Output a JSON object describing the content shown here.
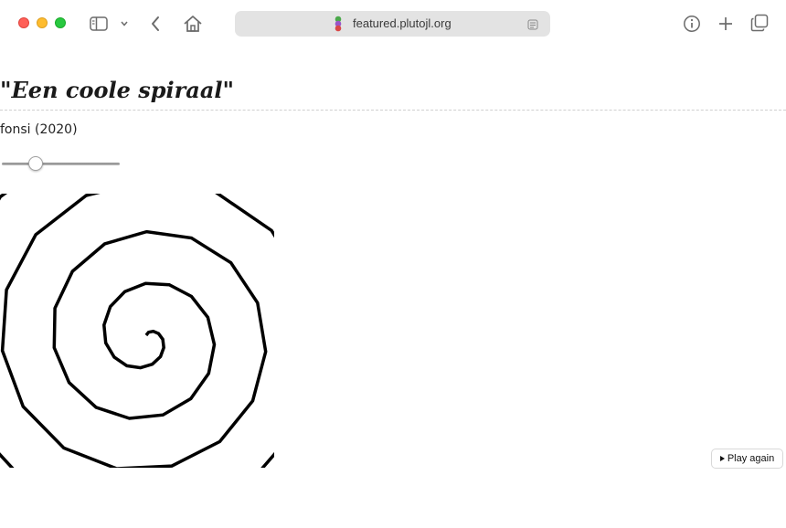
{
  "browser": {
    "address": "featured.plutojl.org",
    "icons": {
      "sidebar": "sidebar-icon",
      "chevron": "chevron-down-icon",
      "back": "back-icon",
      "home": "home-icon",
      "site": "pluto-logo-icon",
      "reader": "reader-mode-icon",
      "info": "info-icon",
      "new_tab": "plus-icon",
      "tabs": "tab-overview-icon"
    }
  },
  "page": {
    "title_open": "\"",
    "title_text": "Een coole spiraal",
    "title_close": "\"",
    "author": "fonsi (2020)",
    "slider": {
      "value_fraction": 0.26
    },
    "play_button": "Play again"
  },
  "colors": {
    "stroke": "#000000",
    "address_bg": "#e3e3e3"
  }
}
